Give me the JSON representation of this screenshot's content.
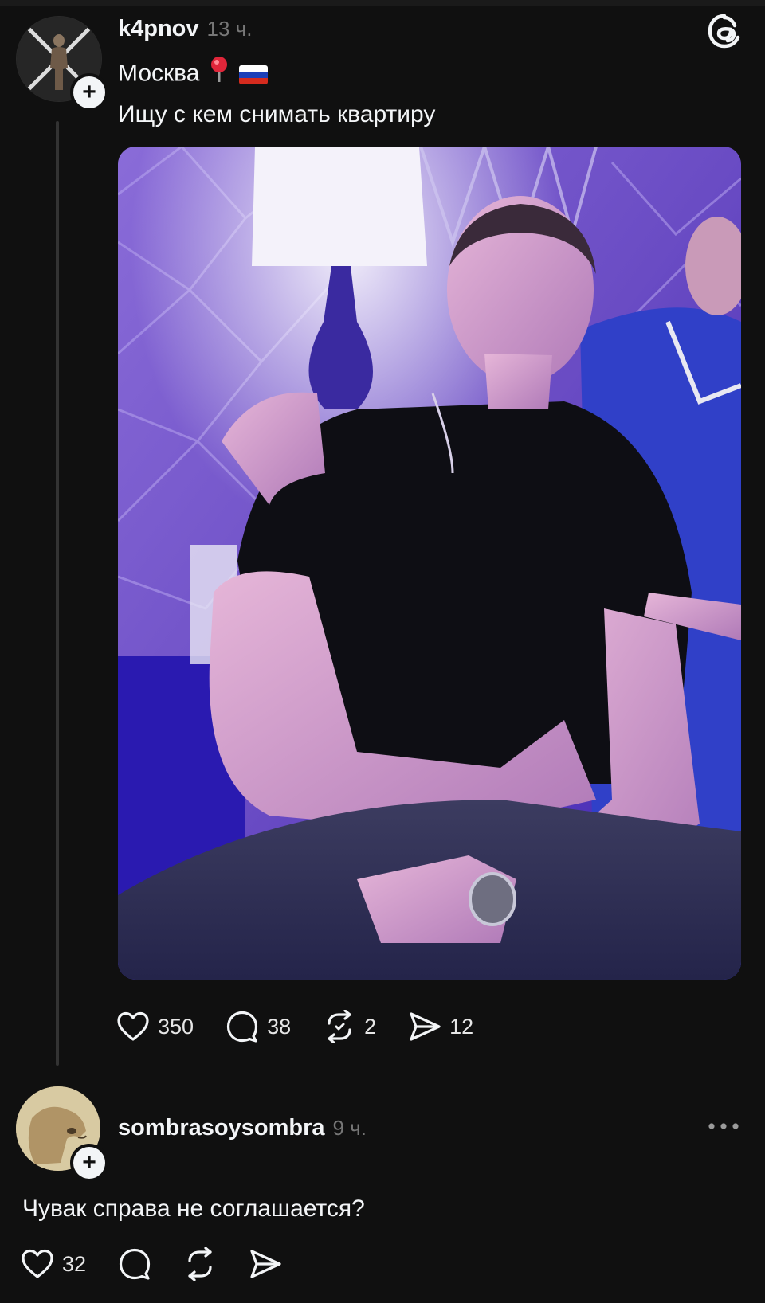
{
  "post": {
    "username": "k4pnov",
    "time": "13 ч.",
    "location": "Москва",
    "location_pin_icon": "round-pushpin-icon",
    "flag_icon": "russia-flag-icon",
    "text": "Ищу с кем снимать квартиру",
    "likes": "350",
    "comments": "38",
    "reposts": "2",
    "shares": "12"
  },
  "reply": {
    "username": "sombrasoysombra",
    "time": "9 ч.",
    "text": "Чувак справа не соглашается?",
    "likes": "32"
  },
  "icons": {
    "like": "heart-icon",
    "comment": "comment-icon",
    "repost": "repost-icon",
    "share": "send-icon",
    "app_logo": "threads-logo-icon",
    "more": "more-options-icon"
  },
  "colors": {
    "background": "#101010",
    "text": "#f3f5f7",
    "secondary_text": "#777777",
    "thread_line": "#333333"
  }
}
